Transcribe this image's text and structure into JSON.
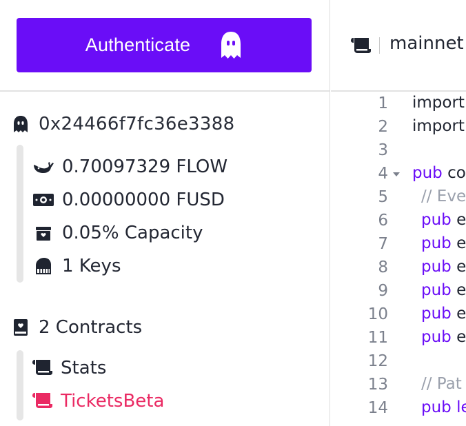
{
  "auth": {
    "label": "Authenticate"
  },
  "network": {
    "name": "mainnet"
  },
  "account": {
    "address": "0x24466f7fc36e3388",
    "stats": [
      {
        "icon": "whale-icon",
        "label": "0.70097329 FLOW"
      },
      {
        "icon": "banknote-icon",
        "label": "0.00000000 FUSD"
      },
      {
        "icon": "storage-box-icon",
        "label": "0.05% Capacity"
      },
      {
        "icon": "piano-keys-icon",
        "label": "1 Keys"
      }
    ]
  },
  "contracts": {
    "summary": "2 Contracts",
    "items": [
      {
        "label": "Stats",
        "active": false
      },
      {
        "label": "TicketsBeta",
        "active": true
      }
    ]
  },
  "editor": {
    "lines": [
      {
        "n": "1",
        "kw": "",
        "rest": "import",
        "comment": "",
        "indent": false,
        "fold": false
      },
      {
        "n": "2",
        "kw": "",
        "rest": "import",
        "comment": "",
        "indent": false,
        "fold": false
      },
      {
        "n": "3",
        "kw": "",
        "rest": "",
        "comment": "",
        "indent": false,
        "fold": false
      },
      {
        "n": "4",
        "kw": "pub",
        "rest": " co",
        "comment": "",
        "indent": false,
        "fold": true
      },
      {
        "n": "5",
        "kw": "",
        "rest": "",
        "comment": "// Eve",
        "indent": true,
        "fold": false
      },
      {
        "n": "6",
        "kw": "pub",
        "rest": " ev",
        "comment": "",
        "indent": true,
        "fold": false
      },
      {
        "n": "7",
        "kw": "pub",
        "rest": " ev",
        "comment": "",
        "indent": true,
        "fold": false
      },
      {
        "n": "8",
        "kw": "pub",
        "rest": " ev",
        "comment": "",
        "indent": true,
        "fold": false
      },
      {
        "n": "9",
        "kw": "pub",
        "rest": " ev",
        "comment": "",
        "indent": true,
        "fold": false
      },
      {
        "n": "10",
        "kw": "pub",
        "rest": " ev",
        "comment": "",
        "indent": true,
        "fold": false
      },
      {
        "n": "11",
        "kw": "pub",
        "rest": " ev",
        "comment": "",
        "indent": true,
        "fold": false
      },
      {
        "n": "12",
        "kw": "",
        "rest": "",
        "comment": "",
        "indent": false,
        "fold": false
      },
      {
        "n": "13",
        "kw": "",
        "rest": "",
        "comment": "// Pat",
        "indent": true,
        "fold": false
      },
      {
        "n": "14",
        "kw": "pub le",
        "rest": "",
        "comment": "",
        "indent": true,
        "fold": false
      }
    ]
  },
  "colors": {
    "accent": "#6a0df7",
    "active_contract": "#ea2a63"
  }
}
